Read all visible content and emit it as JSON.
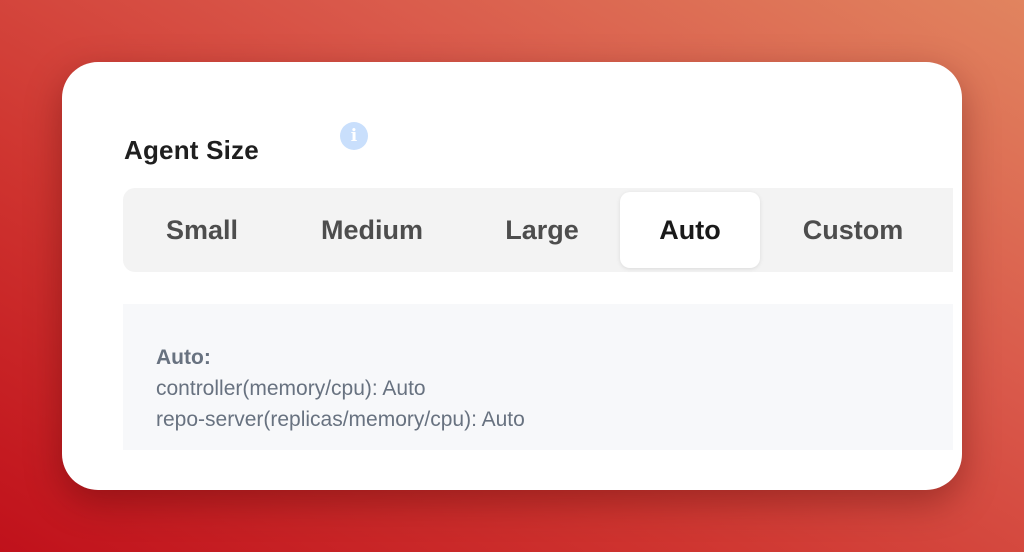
{
  "section": {
    "title": "Agent Size",
    "info_icon": "info-icon"
  },
  "size_options": {
    "selected": "Auto",
    "options": [
      {
        "label": "Small"
      },
      {
        "label": "Medium"
      },
      {
        "label": "Large"
      },
      {
        "label": "Auto"
      },
      {
        "label": "Custom"
      }
    ]
  },
  "description": {
    "heading": "Auto:",
    "lines": [
      "controller(memory/cpu): Auto",
      "repo-server(replicas/memory/cpu): Auto"
    ]
  },
  "colors": {
    "background_gradient": [
      "#c0111b",
      "#e1845f"
    ],
    "card": "#ffffff",
    "segment_track": "#f3f3f3",
    "info_icon": "#c9dffc",
    "description_panel": "#f7f8fa",
    "description_text": "#687280"
  }
}
